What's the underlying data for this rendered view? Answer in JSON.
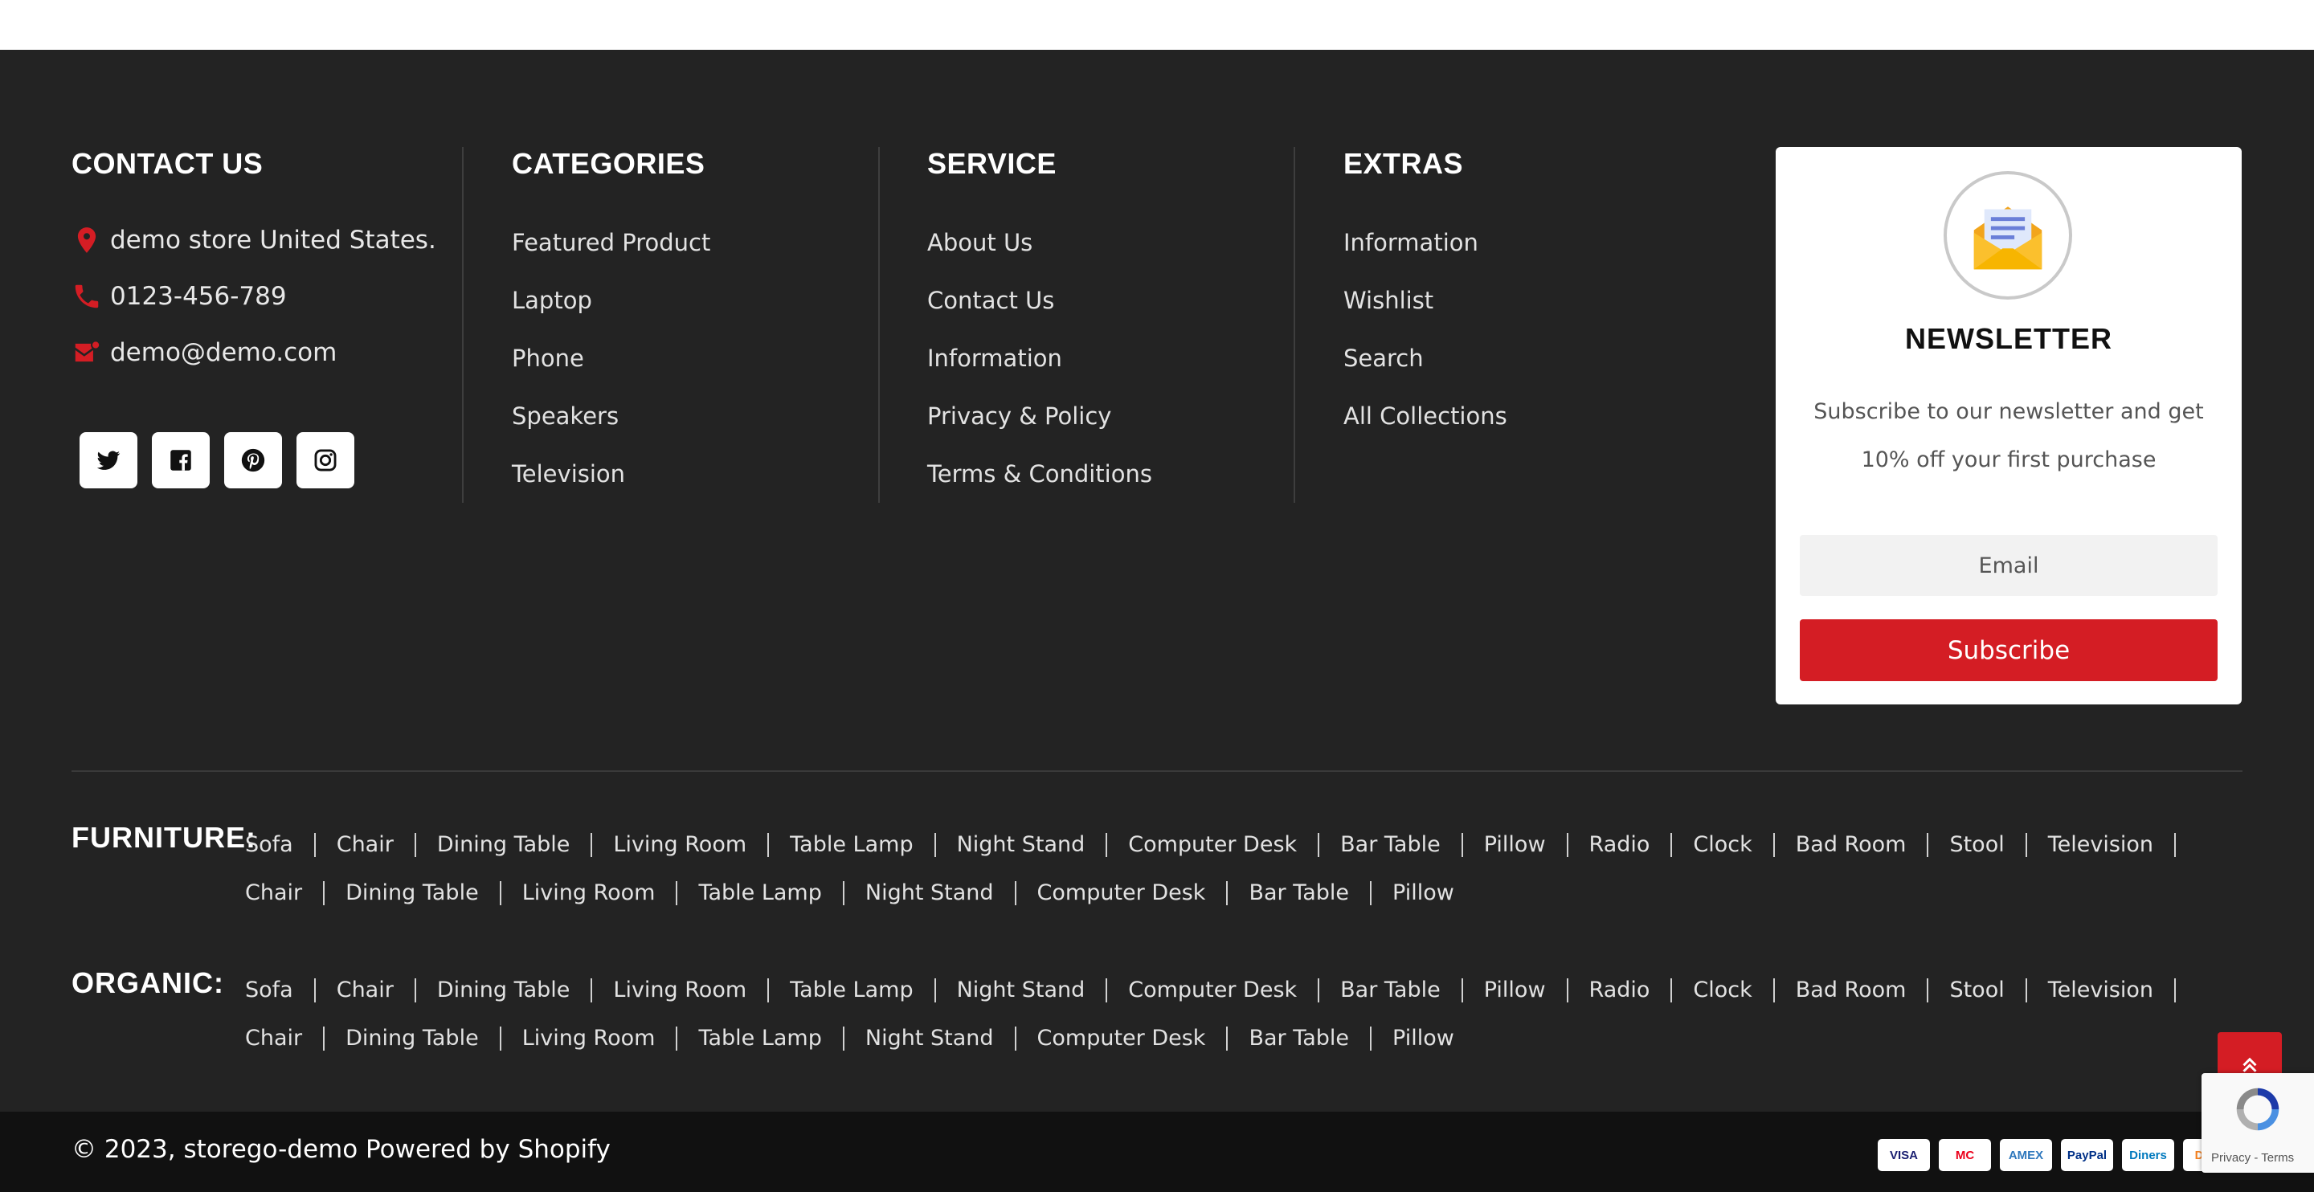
{
  "contact": {
    "title": "CONTACT US",
    "address": "demo store United States.",
    "phone": "0123-456-789",
    "email": "demo@demo.com",
    "social": [
      "twitter-icon",
      "facebook-icon",
      "pinterest-icon",
      "instagram-icon"
    ]
  },
  "categories": {
    "title": "CATEGORIES",
    "items": [
      "Featured Product",
      "Laptop",
      "Phone",
      "Speakers",
      "Television"
    ]
  },
  "service": {
    "title": "SERVICE",
    "items": [
      "About Us",
      "Contact Us",
      "Information",
      "Privacy & Policy",
      "Terms & Conditions"
    ]
  },
  "extras": {
    "title": "EXTRAS",
    "items": [
      "Information",
      "Wishlist",
      "Search",
      "All Collections"
    ]
  },
  "newsletter": {
    "title": "NEWSLETTER",
    "text": "Subscribe to our newsletter and get 10% off your first purchase",
    "email_placeholder": "Email",
    "button_label": "Subscribe"
  },
  "tag_sections": [
    {
      "heading": "FURNITURE:",
      "tags": [
        "Sofa",
        "Chair",
        "Dining Table",
        "Living Room",
        "Table Lamp",
        "Night Stand",
        "Computer Desk",
        "Bar Table",
        "Pillow",
        "Radio",
        "Clock",
        "Bad Room",
        "Stool",
        "Television",
        "Chair",
        "Dining Table",
        "Living Room",
        "Table Lamp",
        "Night Stand",
        "Computer Desk",
        "Bar Table",
        "Pillow"
      ]
    },
    {
      "heading": "ORGANIC:",
      "tags": [
        "Sofa",
        "Chair",
        "Dining Table",
        "Living Room",
        "Table Lamp",
        "Night Stand",
        "Computer Desk",
        "Bar Table",
        "Pillow",
        "Radio",
        "Clock",
        "Bad Room",
        "Stool",
        "Television",
        "Chair",
        "Dining Table",
        "Living Room",
        "Table Lamp",
        "Night Stand",
        "Computer Desk",
        "Bar Table",
        "Pillow"
      ]
    }
  ],
  "footer": {
    "copyright": "© 2023, storego-demo Powered by Shopify",
    "payments": [
      {
        "name": "VISA",
        "color": "#1a1f71"
      },
      {
        "name": "MC",
        "color": "#eb001b"
      },
      {
        "name": "AMEX",
        "color": "#2e77bc"
      },
      {
        "name": "PayPal",
        "color": "#003087"
      },
      {
        "name": "Diners",
        "color": "#0079be"
      },
      {
        "name": "DISC",
        "color": "#f48120"
      }
    ],
    "recaptcha_text": "Privacy - Terms"
  },
  "colors": {
    "accent": "#d41d24",
    "background": "#232323",
    "bottom_bar": "#111111"
  }
}
